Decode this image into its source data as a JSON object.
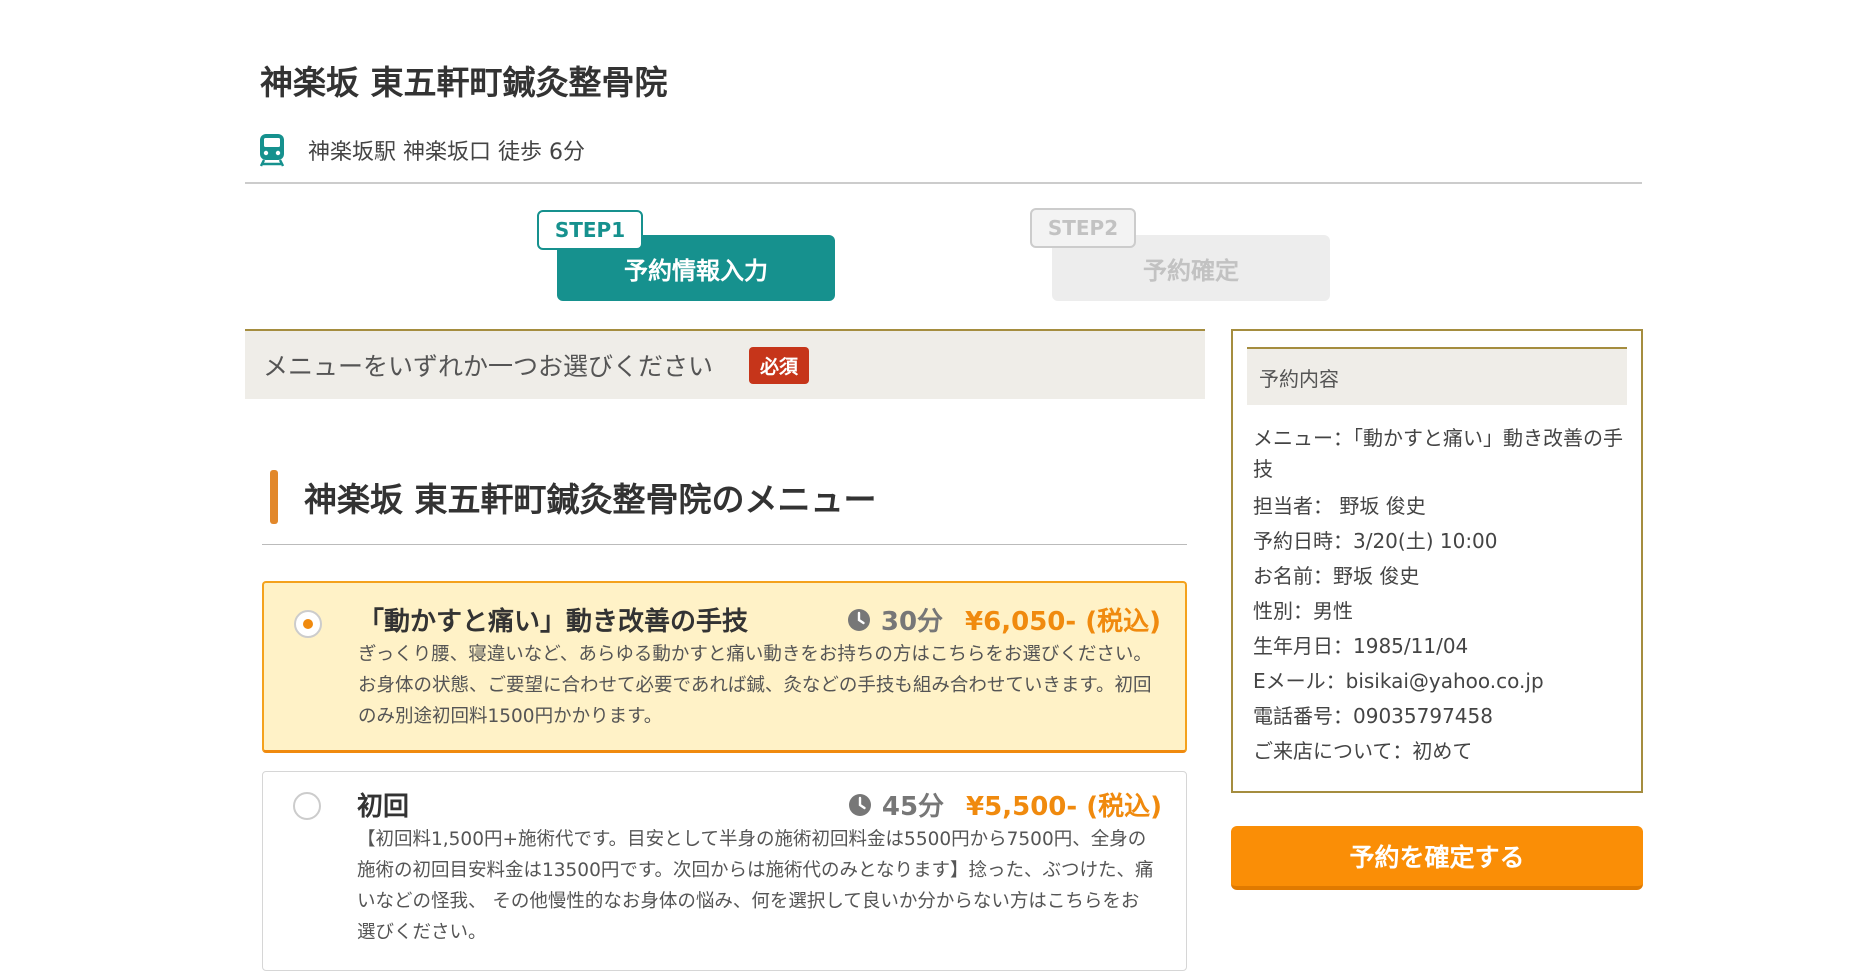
{
  "clinic": {
    "name": "神楽坂 東五軒町鍼灸整骨院",
    "access": "神楽坂駅 神楽坂口 徒歩 6分"
  },
  "steps": [
    {
      "tag": "STEP1",
      "label": "予約情報入力",
      "active": true
    },
    {
      "tag": "STEP2",
      "label": "予約確定",
      "active": false
    }
  ],
  "menu_section": {
    "prompt": "メニューをいずれか一つお選びください",
    "required_badge": "必須",
    "title": "神楽坂 東五軒町鍼灸整骨院のメニュー",
    "items": [
      {
        "name": "「動かすと痛い」動き改善の手技",
        "duration": "30分",
        "price": "¥6,050- (税込)",
        "selected": true,
        "description": "ぎっくり腰、寝違いなど、あらゆる動かすと痛い動きをお持ちの方はこちらをお選びください。お身体の状態、ご要望に合わせて必要であれば鍼、灸などの手技も組み合わせていきます。初回のみ別途初回料1500円かかります。"
      },
      {
        "name": "初回",
        "duration": "45分",
        "price": "¥5,500- (税込)",
        "selected": false,
        "description": "【初回料1,500円+施術代です。目安として半身の施術初回料金は5500円から7500円、全身の施術の初回目安料金は13500円です。次回からは施術代のみとなります】捻った、ぶつけた、痛いなどの怪我、 その他慢性的なお身体の悩み、何を選択して良いか分からない方はこちらをお選びください。"
      }
    ]
  },
  "summary": {
    "heading": "予約内容",
    "lines": [
      "メニュー：「動かすと痛い」動き改善の手技",
      "担当者： 野坂 俊史",
      "予約日時：3/20(土) 10:00",
      "お名前：野坂 俊史",
      "性別：男性",
      "生年月日：1985/11/04",
      "Eメール：bisikai@yahoo.co.jp",
      "電話番号：09035797458",
      "ご来店について：初めて"
    ]
  },
  "confirm_button": "予約を確定する",
  "colors": {
    "teal": "#16918e",
    "orange": "#f08a0e",
    "required_red": "#c6351a",
    "gold_border": "#a58d3f"
  },
  "icons": {
    "train": "train-icon",
    "clock": "clock-icon"
  }
}
